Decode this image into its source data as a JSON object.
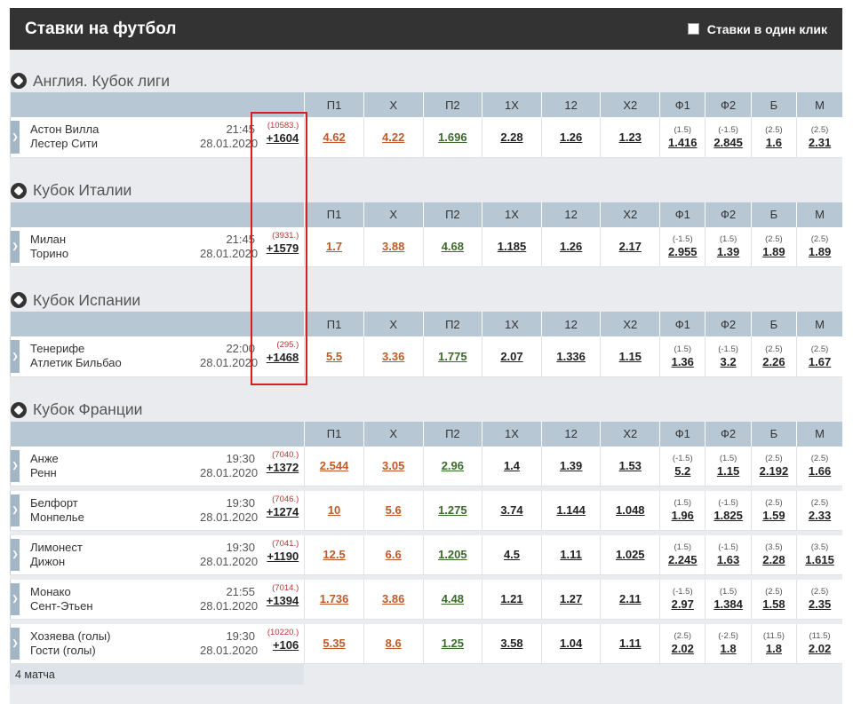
{
  "header": {
    "title": "Ставки на футбол",
    "oneclick_label": "Ставки в один клик"
  },
  "colors": {
    "highlight": "#d42020",
    "orange_odds": "#c05a2a",
    "green_odds": "#3c6a2d",
    "header_bg": "#333333",
    "table_head": "#b8c7d4"
  },
  "columns": [
    "П1",
    "X",
    "П2",
    "1X",
    "12",
    "X2",
    "Ф1",
    "Ф2",
    "Б",
    "М"
  ],
  "leagues": [
    {
      "name": "Англия. Кубок лиги",
      "events": [
        {
          "team1": "Астон Вилла",
          "team2": "Лестер Сити",
          "time": "21:45",
          "date": "28.01.2020",
          "id": "(10583.)",
          "markets": "+1604",
          "odds": [
            "4.62",
            "4.22",
            "1.696",
            "2.28",
            "1.26",
            "1.23"
          ],
          "h": [
            "(1.5)",
            "(-1.5)",
            "(2.5)",
            "(2.5)"
          ],
          "hv": [
            "1.416",
            "2.845",
            "1.6",
            "2.31"
          ]
        }
      ]
    },
    {
      "name": "Кубок Италии",
      "events": [
        {
          "team1": "Милан",
          "team2": "Торино",
          "time": "21:45",
          "date": "28.01.2020",
          "id": "(3931.)",
          "markets": "+1579",
          "odds": [
            "1.7",
            "3.88",
            "4.68",
            "1.185",
            "1.26",
            "2.17"
          ],
          "h": [
            "(-1.5)",
            "(1.5)",
            "(2.5)",
            "(2.5)"
          ],
          "hv": [
            "2.955",
            "1.39",
            "1.89",
            "1.89"
          ]
        }
      ]
    },
    {
      "name": "Кубок Испании",
      "events": [
        {
          "team1": "Тенерифе",
          "team2": "Атлетик Бильбао",
          "time": "22:00",
          "date": "28.01.2020",
          "id": "(295.)",
          "markets": "+1468",
          "odds": [
            "5.5",
            "3.36",
            "1.775",
            "2.07",
            "1.336",
            "1.15"
          ],
          "h": [
            "(1.5)",
            "(-1.5)",
            "(2.5)",
            "(2.5)"
          ],
          "hv": [
            "1.36",
            "3.2",
            "2.26",
            "1.67"
          ]
        }
      ]
    },
    {
      "name": "Кубок Франции",
      "events": [
        {
          "team1": "Анже",
          "team2": "Ренн",
          "time": "19:30",
          "date": "28.01.2020",
          "id": "(7040.)",
          "markets": "+1372",
          "odds": [
            "2.544",
            "3.05",
            "2.96",
            "1.4",
            "1.39",
            "1.53"
          ],
          "h": [
            "(-1.5)",
            "(1.5)",
            "(2.5)",
            "(2.5)"
          ],
          "hv": [
            "5.2",
            "1.15",
            "2.192",
            "1.66"
          ]
        },
        {
          "team1": "Белфорт",
          "team2": "Монпелье",
          "time": "19:30",
          "date": "28.01.2020",
          "id": "(7046.)",
          "markets": "+1274",
          "odds": [
            "10",
            "5.6",
            "1.275",
            "3.74",
            "1.144",
            "1.048"
          ],
          "h": [
            "(1.5)",
            "(-1.5)",
            "(2.5)",
            "(2.5)"
          ],
          "hv": [
            "1.96",
            "1.825",
            "1.59",
            "2.33"
          ]
        },
        {
          "team1": "Лимонест",
          "team2": "Дижон",
          "time": "19:30",
          "date": "28.01.2020",
          "id": "(7041.)",
          "markets": "+1190",
          "odds": [
            "12.5",
            "6.6",
            "1.205",
            "4.5",
            "1.11",
            "1.025"
          ],
          "h": [
            "(1.5)",
            "(-1.5)",
            "(3.5)",
            "(3.5)"
          ],
          "hv": [
            "2.245",
            "1.63",
            "2.28",
            "1.615"
          ]
        },
        {
          "team1": "Монако",
          "team2": "Сент-Этьен",
          "time": "21:55",
          "date": "28.01.2020",
          "id": "(7014.)",
          "markets": "+1394",
          "odds": [
            "1.736",
            "3.86",
            "4.48",
            "1.21",
            "1.27",
            "2.11"
          ],
          "h": [
            "(-1.5)",
            "(1.5)",
            "(2.5)",
            "(2.5)"
          ],
          "hv": [
            "2.97",
            "1.384",
            "1.58",
            "2.35"
          ]
        },
        {
          "team1": "Хозяева (голы)",
          "team2": "Гости (голы)",
          "time": "19:30",
          "date": "28.01.2020",
          "id": "(10220.)",
          "markets": "+106",
          "odds": [
            "5.35",
            "8.6",
            "1.25",
            "3.58",
            "1.04",
            "1.11"
          ],
          "h": [
            "(2.5)",
            "(-2.5)",
            "(11.5)",
            "(11.5)"
          ],
          "hv": [
            "2.02",
            "1.8",
            "1.8",
            "2.02"
          ]
        }
      ],
      "footer": "4 матча"
    }
  ]
}
